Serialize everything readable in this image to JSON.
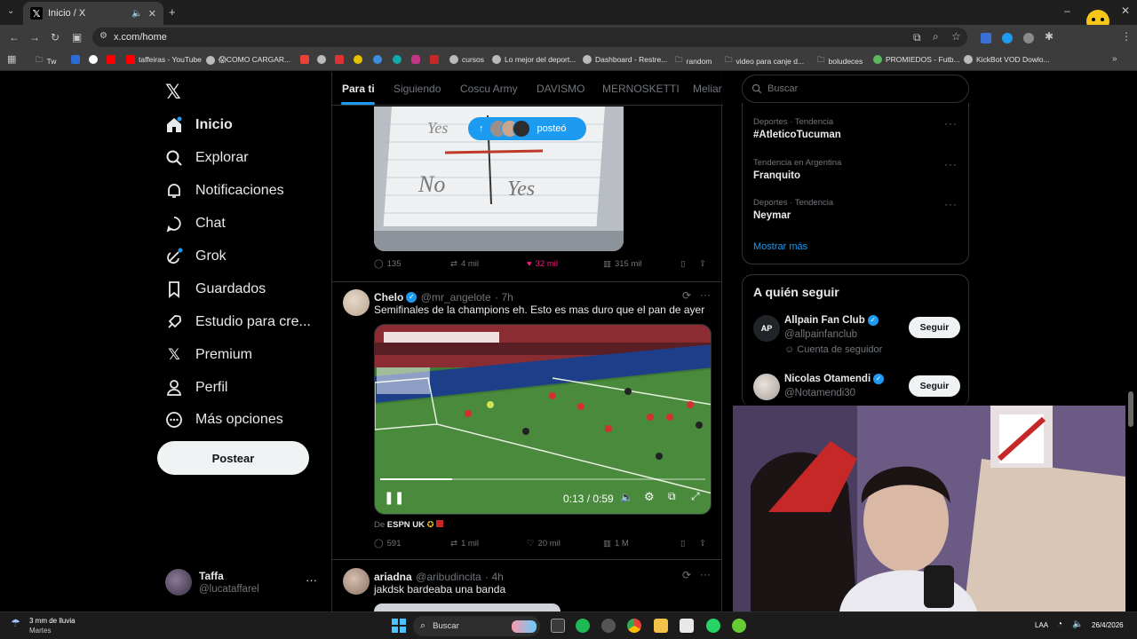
{
  "browser": {
    "tab_title": "Inicio / X",
    "url": "x.com/home",
    "bookmarks": [
      "Tw",
      "taffeiras - YouTube",
      "😱COMO CARGAR...",
      "cursos",
      "Lo mejor del deport...",
      "Dashboard - Restre...",
      "random",
      "video para canje d...",
      "boludeces",
      "PROMIEDOS - Futb...",
      "KickBot VOD Dowlo..."
    ]
  },
  "nav": {
    "items": [
      {
        "label": "Inicio",
        "icon": "home-icon"
      },
      {
        "label": "Explorar",
        "icon": "search-icon"
      },
      {
        "label": "Notificaciones",
        "icon": "bell-icon"
      },
      {
        "label": "Chat",
        "icon": "chat-icon"
      },
      {
        "label": "Grok",
        "icon": "grok-icon"
      },
      {
        "label": "Guardados",
        "icon": "bookmark-icon"
      },
      {
        "label": "Estudio para cre...",
        "icon": "rocket-icon"
      },
      {
        "label": "Premium",
        "icon": "x-icon"
      },
      {
        "label": "Perfil",
        "icon": "person-icon"
      },
      {
        "label": "Más opciones",
        "icon": "more-circle-icon"
      }
    ],
    "post_button": "Postear",
    "account": {
      "name": "Taffa",
      "handle": "@lucataffarel"
    }
  },
  "feed": {
    "tabs": [
      "Para ti",
      "Siguiendo",
      "Coscu Army",
      "DAVISMO",
      "MERNOSKETTI",
      "Meliar"
    ],
    "new_posts_pill": "posteó",
    "tweet1": {
      "replies": "135",
      "retweets": "4 mil",
      "likes": "32 mil",
      "views": "315 mil"
    },
    "tweet2": {
      "name": "Chelo",
      "handle": "@mr_angelote",
      "time": "· 7h",
      "text": "Semifinales de la champions eh. Esto es mas duro que el pan de ayer",
      "video_time": "0:13 / 0:59",
      "video_progress": 0.22,
      "source_prefix": "De",
      "source": "ESPN UK",
      "replies": "591",
      "retweets": "1 mil",
      "likes": "20 mil",
      "views": "1 M"
    },
    "tweet3": {
      "name": "ariadna",
      "handle": "@aribudincita",
      "time": "· 4h",
      "text": "jakdsk bardeaba una banda"
    }
  },
  "sidebar": {
    "search_placeholder": "Buscar",
    "trends": [
      {
        "category": "Deportes · Tendencia",
        "name": "#AtleticoTucuman"
      },
      {
        "category": "Tendencia en Argentina",
        "name": "Franquito"
      },
      {
        "category": "Deportes · Tendencia",
        "name": "Neymar"
      }
    ],
    "show_more": "Mostrar más",
    "who_to_follow_title": "A quién seguir",
    "follow": [
      {
        "name": "Allpain Fan Club",
        "handle": "@allpainfanclub",
        "note": "Cuenta de seguidor",
        "button": "Seguir"
      },
      {
        "name": "Nicolas Otamendi",
        "handle": "@Notamendi30",
        "button": "Seguir"
      }
    ]
  },
  "taskbar": {
    "weather_title": "3 mm de lluvia",
    "weather_sub": "Martes",
    "search": "Buscar",
    "lang": "LAA",
    "date": "26/4/2026"
  },
  "colors": {
    "accent": "#1d9bf0",
    "like": "#f91880",
    "bg": "#000000"
  }
}
